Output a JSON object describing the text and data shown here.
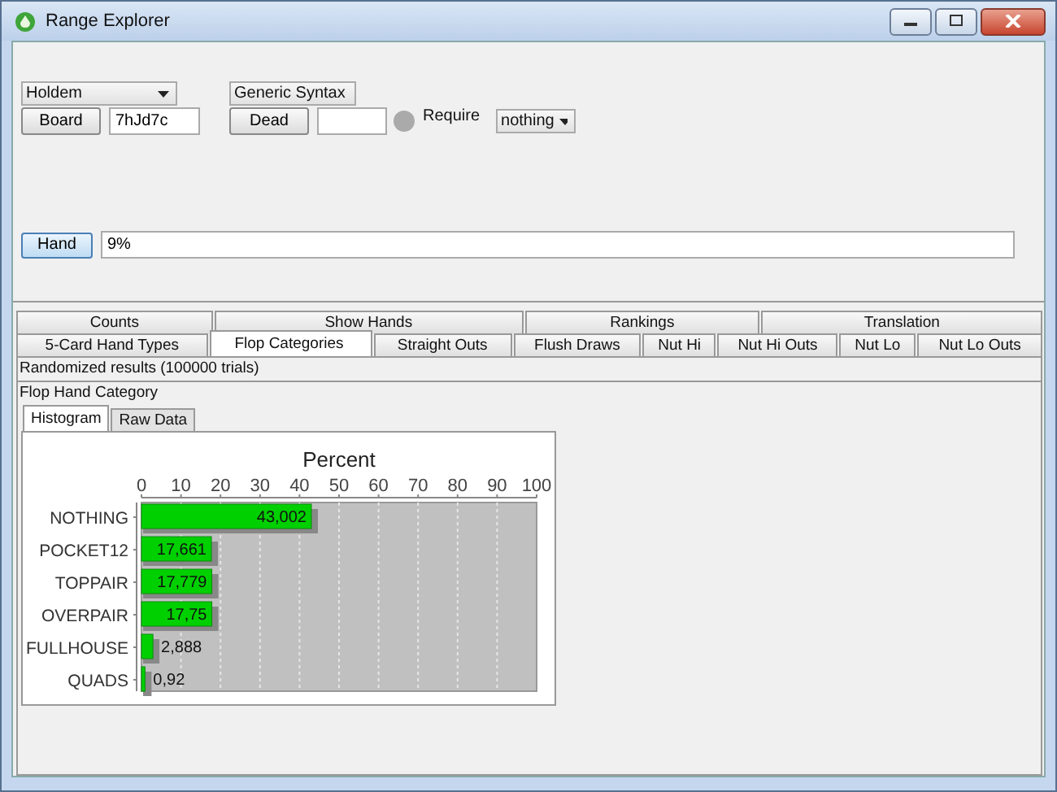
{
  "window": {
    "title": "Range Explorer"
  },
  "controls": {
    "game_select": {
      "value": "Holdem"
    },
    "board_button": "Board",
    "board_field": {
      "value": "7hJd7c"
    },
    "syntax_select": {
      "value": "Generic Syntax"
    },
    "dead_button": "Dead",
    "require_indicator": {
      "on": false
    },
    "require_label": "Require",
    "require_select": {
      "value": "nothing"
    },
    "hand_button": "Hand",
    "hand_field": {
      "value": "9%"
    }
  },
  "tabs_row1": [
    {
      "label": "Counts",
      "selected": false
    },
    {
      "label": "Show Hands",
      "selected": false
    },
    {
      "label": "Rankings",
      "selected": false
    },
    {
      "label": "Translation",
      "selected": false
    }
  ],
  "tabs_row2": [
    {
      "label": "5-Card Hand Types",
      "selected": false
    },
    {
      "label": "Flop Categories",
      "selected": true
    },
    {
      "label": "Straight Outs",
      "selected": false
    },
    {
      "label": "Flush Draws",
      "selected": false
    },
    {
      "label": "Nut Hi",
      "selected": false
    },
    {
      "label": "Nut Hi Outs",
      "selected": false
    },
    {
      "label": "Nut Lo",
      "selected": false
    },
    {
      "label": "Nut Lo Outs",
      "selected": false
    }
  ],
  "results_header": "Randomized results (100000 trials)",
  "section_title": "Flop Hand Category",
  "subtabs": [
    {
      "label": "Histogram",
      "selected": true
    },
    {
      "label": "Raw Data",
      "selected": false
    }
  ],
  "chart_data": {
    "type": "bar",
    "orientation": "horizontal",
    "title": "Percent",
    "categories": [
      "NOTHING",
      "POCKET12",
      "TOPPAIR",
      "OVERPAIR",
      "FULLHOUSE",
      "QUADS"
    ],
    "series": [
      {
        "color": "#00d000",
        "values": [
          43.0,
          17.7,
          17.8,
          17.8,
          2.9,
          0.9
        ]
      }
    ],
    "grid": true,
    "value_labels": [
      "43,002",
      "17,661",
      "17,779",
      "17,75",
      "2,888",
      "0,92"
    ],
    "xlim": [
      0,
      100
    ],
    "xticks": [
      0,
      10,
      20,
      30,
      40,
      50,
      60,
      70,
      80,
      90,
      100
    ]
  }
}
